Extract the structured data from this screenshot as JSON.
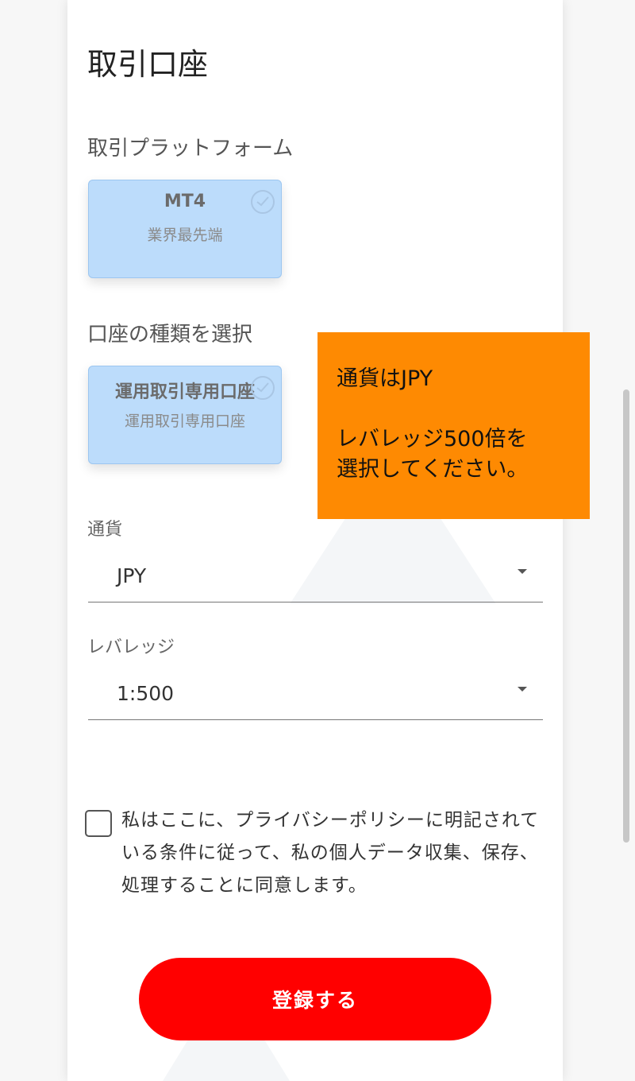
{
  "page": {
    "title": "取引口座"
  },
  "platform": {
    "label": "取引プラットフォーム",
    "option": {
      "title": "MT4",
      "subtitle": "業界最先端",
      "selected": true
    }
  },
  "account_type": {
    "label": "口座の種類を選択",
    "option": {
      "title": "運用取引専用口座",
      "subtitle": "運用取引専用口座",
      "selected": true
    }
  },
  "currency": {
    "label": "通貨",
    "value": "JPY",
    "icon": "chevron-down-icon"
  },
  "leverage": {
    "label": "レバレッジ",
    "value": "1:500",
    "icon": "chevron-down-icon"
  },
  "consent": {
    "checked": false,
    "text": "私はここに、プライバシーポリシーに明記されている条件に従って、私の個人データ収集、保存、処理することに同意します。"
  },
  "register_button": {
    "label": "登録する",
    "color": "#ff0000"
  },
  "callout": {
    "line1": "通貨はJPY",
    "line2": "レバレッジ500倍を",
    "line3": "選択してください。",
    "color": "#fe8a02"
  },
  "colors": {
    "selected_card": "#bcdcfb",
    "accent": "#ff0000"
  }
}
